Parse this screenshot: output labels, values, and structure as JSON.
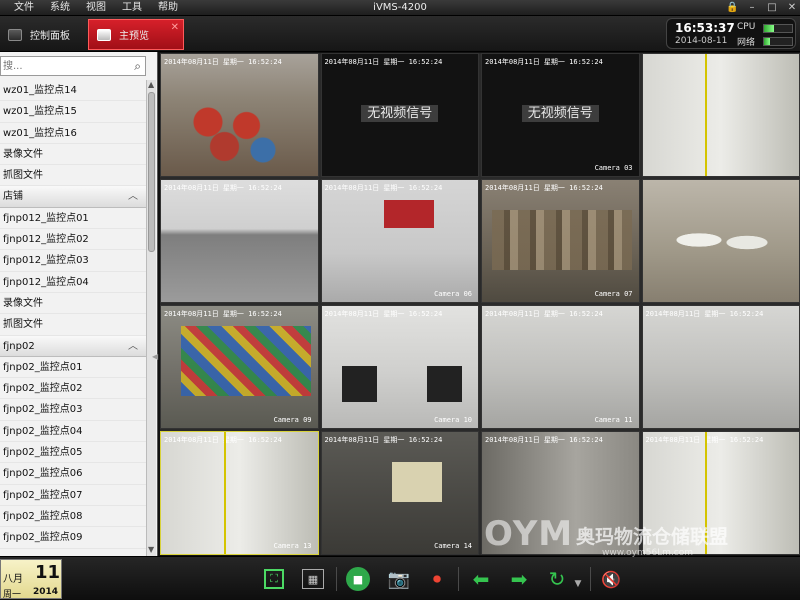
{
  "menu": [
    "文件",
    "系统",
    "视图",
    "工具",
    "帮助"
  ],
  "app_title": "iVMS-4200",
  "window_controls": {
    "lock": "🔒",
    "minimize": "–",
    "maximize": "□",
    "close": "✕"
  },
  "tabs": {
    "control_panel": "控制面板",
    "main_preview": "主预览",
    "close": "✕"
  },
  "status": {
    "time": "16:53:37",
    "date": "2014-08-11",
    "cpu_label": "CPU",
    "network_label": "网络",
    "cpu_level": 0.35,
    "network_level": 0.2
  },
  "search": {
    "value": "",
    "placeholder": "搜..."
  },
  "tree": [
    {
      "type": "item",
      "label": "wz01_监控点14"
    },
    {
      "type": "item",
      "label": "wz01_监控点15"
    },
    {
      "type": "item",
      "label": "wz01_监控点16"
    },
    {
      "type": "item",
      "label": "录像文件"
    },
    {
      "type": "item",
      "label": "抓图文件"
    },
    {
      "type": "group",
      "label": "店铺"
    },
    {
      "type": "item",
      "label": "fjnp012_监控点01"
    },
    {
      "type": "item",
      "label": "fjnp012_监控点02"
    },
    {
      "type": "item",
      "label": "fjnp012_监控点03"
    },
    {
      "type": "item",
      "label": "fjnp012_监控点04"
    },
    {
      "type": "item",
      "label": "录像文件"
    },
    {
      "type": "item",
      "label": "抓图文件"
    },
    {
      "type": "group",
      "label": "fjnp02"
    },
    {
      "type": "item",
      "label": "fjnp02_监控点01"
    },
    {
      "type": "item",
      "label": "fjnp02_监控点02"
    },
    {
      "type": "item",
      "label": "fjnp02_监控点03"
    },
    {
      "type": "item",
      "label": "fjnp02_监控点04"
    },
    {
      "type": "item",
      "label": "fjnp02_监控点05"
    },
    {
      "type": "item",
      "label": "fjnp02_监控点06"
    },
    {
      "type": "item",
      "label": "fjnp02_监控点07"
    },
    {
      "type": "item",
      "label": "fjnp02_监控点08"
    },
    {
      "type": "item",
      "label": "fjnp02_监控点09"
    }
  ],
  "cameras": [
    {
      "ts": "2014年08月11日 星期一 16:52:24",
      "name": "",
      "no_signal": "",
      "scene": "sc-yard"
    },
    {
      "ts": "2014年08月11日 星期一 16:52:24",
      "name": "",
      "no_signal": "无视频信号",
      "scene": "sc-dark"
    },
    {
      "ts": "2014年08月11日 星期一 16:52:24",
      "name": "Camera 03",
      "no_signal": "无视频信号",
      "scene": "sc-dark"
    },
    {
      "ts": "",
      "name": "",
      "no_signal": "",
      "scene": "sc-corridor"
    },
    {
      "ts": "2014年08月11日 星期一 16:52:24",
      "name": "",
      "no_signal": "",
      "scene": "sc-wall"
    },
    {
      "ts": "2014年08月11日 星期一 16:52:24",
      "name": "Camera 06",
      "no_signal": "",
      "scene": "sc-room-red"
    },
    {
      "ts": "2014年08月11日 星期一 16:52:24",
      "name": "Camera 07",
      "no_signal": "",
      "scene": "sc-ware"
    },
    {
      "ts": "",
      "name": "",
      "no_signal": "",
      "scene": "sc-sacks"
    },
    {
      "ts": "2014年08月11日 星期一 16:52:24",
      "name": "Camera 09",
      "no_signal": "",
      "scene": "sc-colorful"
    },
    {
      "ts": "2014年08月11日 星期一 16:52:24",
      "name": "Camera 10",
      "no_signal": "",
      "scene": "sc-lobby"
    },
    {
      "ts": "2014年08月11日 星期一 16:52:24",
      "name": "Camera 11",
      "no_signal": "",
      "scene": "sc-tiles"
    },
    {
      "ts": "2014年08月11日 星期一 16:52:24",
      "name": "",
      "no_signal": "",
      "scene": "sc-tiles"
    },
    {
      "ts": "2014年08月11日 星期一 16:52:24",
      "name": "Camera 13",
      "no_signal": "",
      "scene": "sc-corridor",
      "selected": true
    },
    {
      "ts": "2014年08月11日 星期一 16:52:24",
      "name": "Camera 14",
      "no_signal": "",
      "scene": "sc-door"
    },
    {
      "ts": "2014年08月11日 星期一 16:52:24",
      "name": "",
      "no_signal": "",
      "scene": "sc-shelves"
    },
    {
      "ts": "2014年08月11日 星期一 16:52:24",
      "name": "",
      "no_signal": "",
      "scene": "sc-corridor"
    }
  ],
  "calendar": {
    "month": "八月",
    "day": "11",
    "weekday": "周一",
    "year": "2014"
  },
  "toolbar_icons": {
    "fullscreen": "⛶",
    "layout": "▦",
    "stop_all": "■",
    "capture": "📷",
    "record": "⏺",
    "previous": "⬅",
    "next": "➡",
    "cycle": "↻",
    "cycle_menu": "▼",
    "mute": "🔇"
  },
  "watermark": {
    "logo": "OYM",
    "name": "奥玛物流仓储联盟",
    "url": "www.oym56Lm.com"
  },
  "colors": {
    "active_tab": "#d6202a",
    "accent_green": "#35c44f",
    "selected_border": "#d8d23a"
  }
}
